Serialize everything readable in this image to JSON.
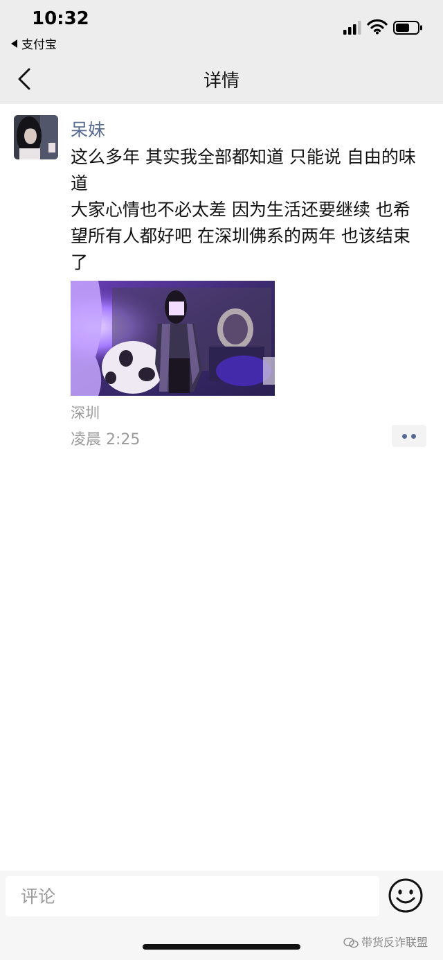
{
  "status_bar": {
    "time": "10:32",
    "back_app_label": "支付宝",
    "signal_icon": "cellular-signal-icon",
    "wifi_icon": "wifi-icon",
    "battery_icon": "battery-icon"
  },
  "nav": {
    "title": "详情",
    "back_icon": "chevron-left-icon"
  },
  "post": {
    "author": "呆妹",
    "content_lines": [
      "这么多年 其实我全部都知道 只能说 自由的味道",
      "大家心情也不必太差 因为生活还要继续 也希望所有人都好吧 在深圳佛系的两年 也该结束了"
    ],
    "location": "深圳",
    "timestamp": "凌晨 2:25",
    "more_icon": "more-dots-icon"
  },
  "bottom": {
    "comment_placeholder": "评论",
    "emoji_icon": "emoji-smile-icon",
    "watermark": "带货反诈联盟"
  },
  "colors": {
    "bar_bg": "#ededed",
    "author": "#576b95",
    "meta_gray": "#9a9a9a",
    "bottom_bg": "#f6f6f6"
  }
}
